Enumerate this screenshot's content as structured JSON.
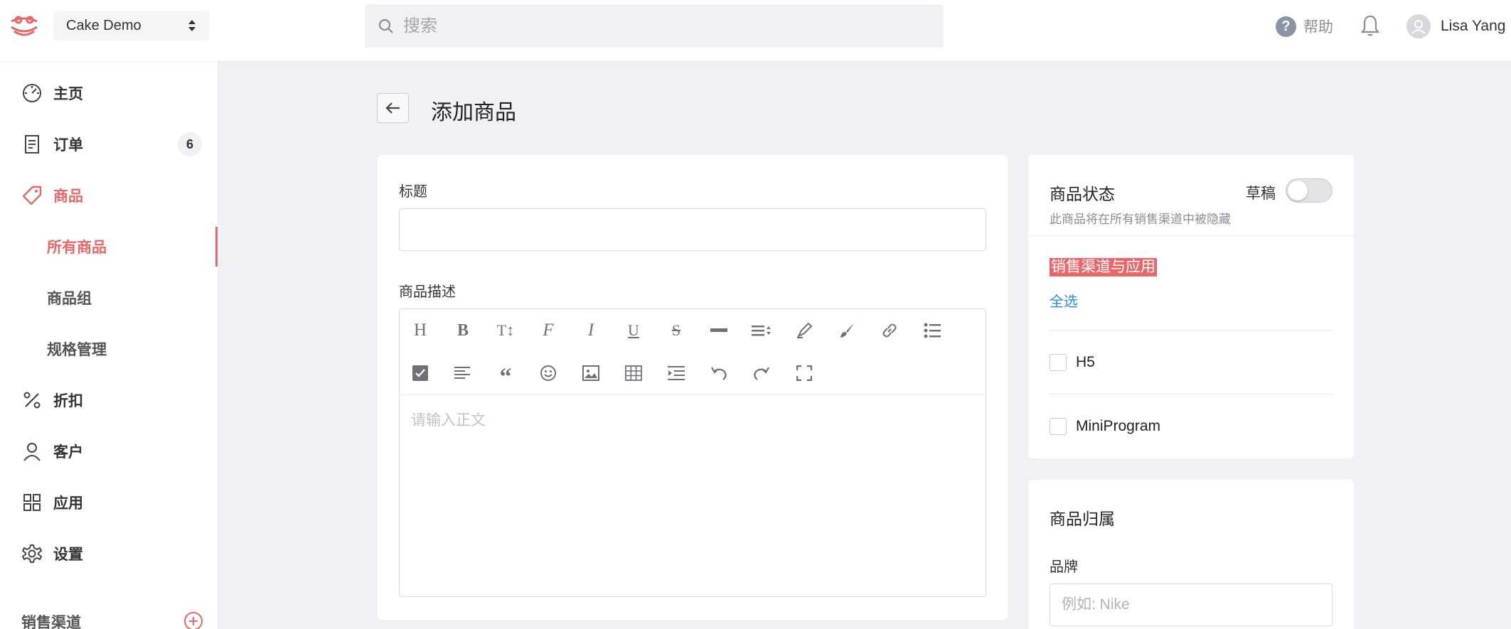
{
  "header": {
    "store_name": "Cake Demo",
    "search_placeholder": "搜索",
    "help_label": "帮助",
    "user_name": "Lisa Yang"
  },
  "sidebar": {
    "items": [
      {
        "label": "主页",
        "icon": "dashboard-icon"
      },
      {
        "label": "订单",
        "icon": "receipt-icon",
        "badge": "6"
      },
      {
        "label": "商品",
        "icon": "tag-icon",
        "active": true
      },
      {
        "label": "所有商品",
        "sub": true,
        "active": true
      },
      {
        "label": "商品组",
        "sub": true
      },
      {
        "label": "规格管理",
        "sub": true
      },
      {
        "label": "折扣",
        "icon": "percent-icon"
      },
      {
        "label": "客户",
        "icon": "user-icon"
      },
      {
        "label": "应用",
        "icon": "apps-grid-icon"
      },
      {
        "label": "设置",
        "icon": "gear-icon"
      }
    ],
    "section_label": "销售渠道"
  },
  "main": {
    "page_title": "添加商品",
    "title_label": "标题",
    "title_value": "",
    "description_label": "商品描述",
    "editor_placeholder": "请输入正文",
    "toolbar_row1": [
      "heading-icon",
      "bold-icon",
      "text-size-icon",
      "font-icon",
      "italic-icon",
      "underline-icon",
      "strikethrough-icon",
      "horizontal-rule-icon",
      "line-height-icon",
      "highlight-icon",
      "brush-icon",
      "link-icon",
      "bullet-list-icon"
    ],
    "toolbar_row2": [
      "checkbox-list-icon",
      "align-left-icon",
      "quote-icon",
      "emoji-icon",
      "image-icon",
      "table-icon",
      "indent-icon",
      "undo-icon",
      "redo-icon",
      "fullscreen-icon"
    ]
  },
  "status_card": {
    "title": "商品状态",
    "draft_label": "草稿",
    "toggle_on": false,
    "subtitle": "此商品将在所有销售渠道中被隐藏",
    "channels_title": "销售渠道与应用",
    "select_all": "全选",
    "channels": [
      "H5",
      "MiniProgram"
    ]
  },
  "brand_card": {
    "title": "商品归属",
    "brand_label": "品牌",
    "brand_placeholder": "例如: Nike"
  },
  "colors": {
    "accent": "#e8676a",
    "link": "#2e8be8",
    "background": "#f0f1f5"
  }
}
